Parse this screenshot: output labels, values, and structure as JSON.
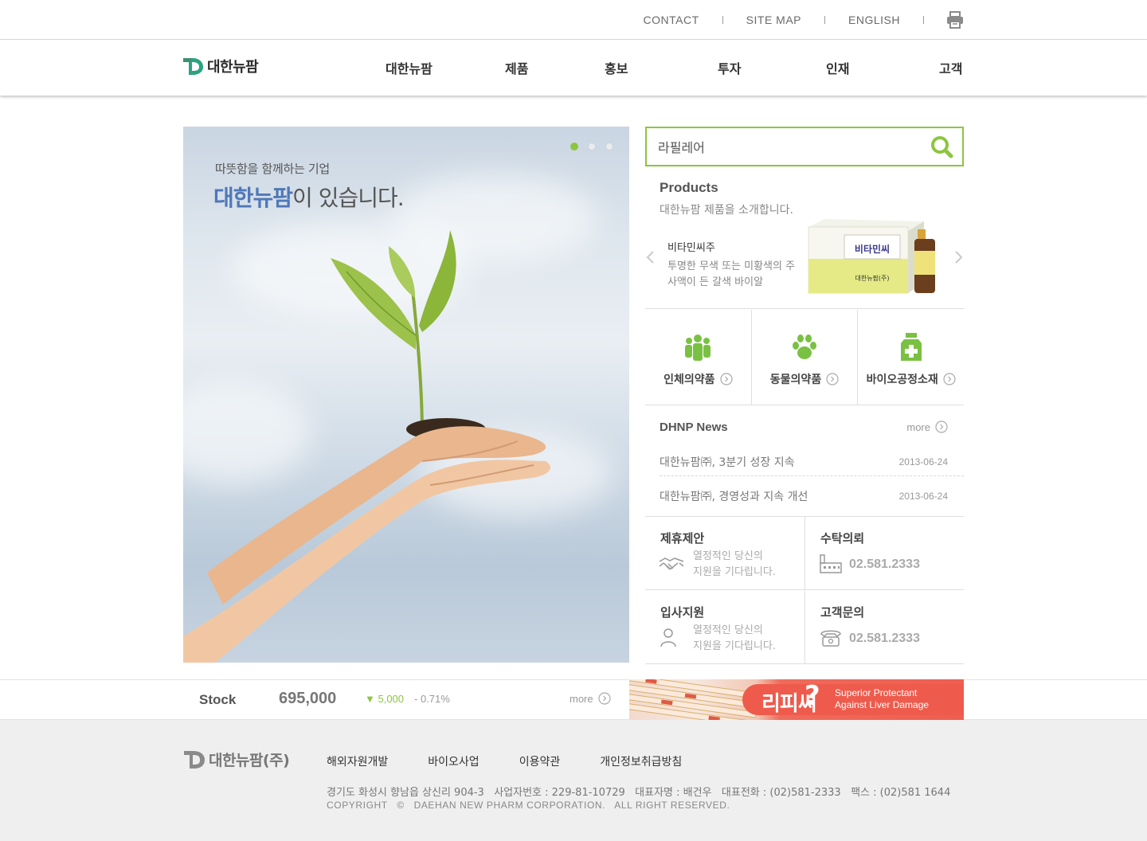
{
  "top_links": {
    "contact": "CONTACT",
    "sitemap": "SITE MAP",
    "english": "ENGLISH",
    "print_icon": "printer-icon"
  },
  "logo": {
    "text": "대한뉴팜",
    "brand_color": "#2aa380"
  },
  "menu": [
    "대한뉴팜",
    "제품",
    "홍보",
    "투자",
    "인재",
    "고객"
  ],
  "hero": {
    "line1": "따뜻함을 함께하는 기업",
    "brand": "대한뉴팜",
    "line2_rest": "이 있습니다.",
    "slides_total": 3,
    "active_slide": 1
  },
  "search": {
    "value": "라필레어",
    "icon": "search-icon"
  },
  "products": {
    "title": "Products",
    "subtitle": "대한뉴팜 제품을 소개합니다.",
    "item_name": "비타민씨주",
    "item_desc": "투명한 무색 또는 미황색의 주사액이 든 갈색 바이알",
    "box_label": "비타민씨",
    "box_brand": "대한뉴팜(주)"
  },
  "categories": [
    {
      "label": "인체의약품",
      "icon": "people-icon"
    },
    {
      "label": "동물의약품",
      "icon": "paw-icon"
    },
    {
      "label": "바이오공정소재",
      "icon": "bottle-plus-icon"
    }
  ],
  "news": {
    "title": "DHNP News",
    "more": "more",
    "items": [
      {
        "title": "대한뉴팜㈜, 3분기 성장 지속",
        "date": "2013-06-24"
      },
      {
        "title": "대한뉴팜㈜, 경영성과 지속 개선",
        "date": "2013-06-24"
      }
    ]
  },
  "quick": {
    "partnership": {
      "title": "제휴제안",
      "desc1": "열정적인 당신의",
      "desc2": "지원을 기다립니다."
    },
    "consign": {
      "title": "수탁의뢰",
      "phone": "02.581.2333"
    },
    "apply": {
      "title": "입사지원",
      "desc1": "열정적인 당신의",
      "desc2": "지원을 기다립니다."
    },
    "customer": {
      "title": "고객문의",
      "phone": "02.581.2333"
    }
  },
  "stock": {
    "label": "Stock",
    "price": "695,000",
    "change": "▼ 5,000",
    "percent": "- 0.71%",
    "more": "more"
  },
  "banner": {
    "name": "리피씨",
    "mark": "?",
    "tag1": "Superior Protectant",
    "tag2": "Against Liver Damage"
  },
  "footer": {
    "logo_text": "대한뉴팜(주)",
    "links": [
      "해외자원개발",
      "바이오사업",
      "이용약관",
      "개인정보취급방침"
    ],
    "address": "경기도 화성시 향남읍 상신리 904-3   사업자번호 : 229-81-10729   대표자명 : 배건우   대표전화 : (02)581-2333   팩스 : (02)581 1644",
    "copyright": "COPYRIGHT   ©   DAEHAN NEW PHARM CORPORATION.   ALL RIGHT RESERVED."
  },
  "colors": {
    "accent_green": "#8cc63f",
    "brand_blue": "#4f78b8",
    "banner_red": "#ee5b4d"
  }
}
